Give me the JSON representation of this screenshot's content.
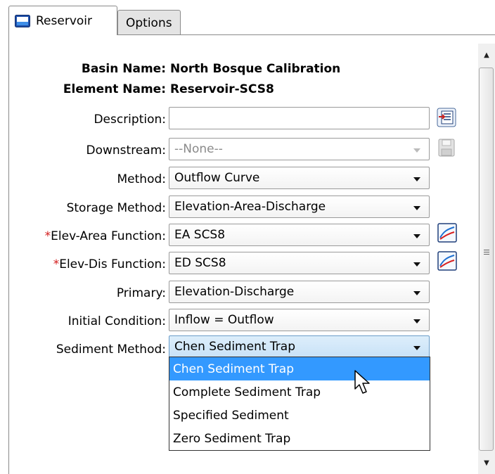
{
  "tabs": [
    {
      "label": "Reservoir",
      "active": true
    },
    {
      "label": "Options",
      "active": false
    }
  ],
  "header": {
    "basin_label": "Basin Name:",
    "basin_value": "North Bosque Calibration",
    "element_label": "Element Name:",
    "element_value": "Reservoir-SCS8"
  },
  "fields": {
    "description": {
      "label": "Description:",
      "value": ""
    },
    "downstream": {
      "label": "Downstream:",
      "value": "--None--"
    },
    "method": {
      "label": "Method:",
      "value": "Outflow Curve"
    },
    "storage_method": {
      "label": "Storage Method:",
      "value": "Elevation-Area-Discharge"
    },
    "elev_area": {
      "required_mark": "*",
      "label": "Elev-Area Function:",
      "value": "EA SCS8"
    },
    "elev_dis": {
      "required_mark": "*",
      "label": "Elev-Dis Function:",
      "value": "ED SCS8"
    },
    "primary": {
      "label": "Primary:",
      "value": "Elevation-Discharge"
    },
    "initial_condition": {
      "label": "Initial Condition:",
      "value": "Inflow = Outflow"
    },
    "sediment_method": {
      "label": "Sediment Method:",
      "value": "Chen Sediment Trap"
    }
  },
  "sediment_options": [
    "Chen Sediment Trap",
    "Complete Sediment Trap",
    "Specified Sediment",
    "Zero Sediment Trap"
  ],
  "icons": {
    "tab": "reservoir-icon",
    "description_button": "description-editor-icon",
    "downstream_button": "save-disk-icon",
    "function_button": "chart-graph-icon"
  },
  "colors": {
    "required": "#d31b1b",
    "selection": "#3399ff",
    "active_field": "#c8e2f7"
  }
}
